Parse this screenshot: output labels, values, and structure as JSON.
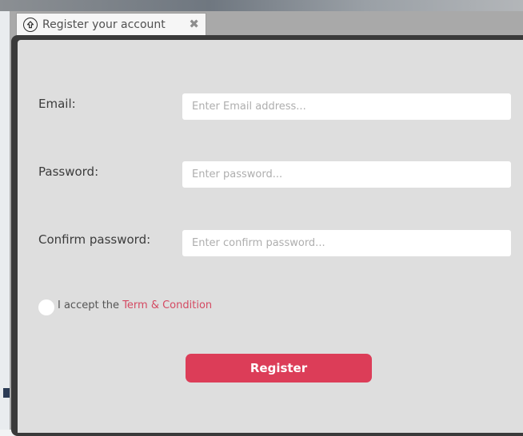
{
  "tab": {
    "title": "Register your account",
    "icon": "upload-circle-icon",
    "close_icon": "close-icon"
  },
  "form": {
    "email_label": "Email:",
    "email_placeholder": "Enter Email address...",
    "email_value": "",
    "password_label": "Password:",
    "password_placeholder": "Enter password...",
    "password_value": "",
    "confirm_label": "Confirm password:",
    "confirm_placeholder": "Enter confirm password...",
    "confirm_value": "",
    "accept_prefix": "I accept the",
    "accept_link": "Term & Condition",
    "accept_checked": false,
    "register_label": "Register"
  },
  "colors": {
    "accent": "#dc3d58",
    "link": "#d44a62",
    "panel_background": "#dedede",
    "panel_frame": "#3a3a3a"
  }
}
